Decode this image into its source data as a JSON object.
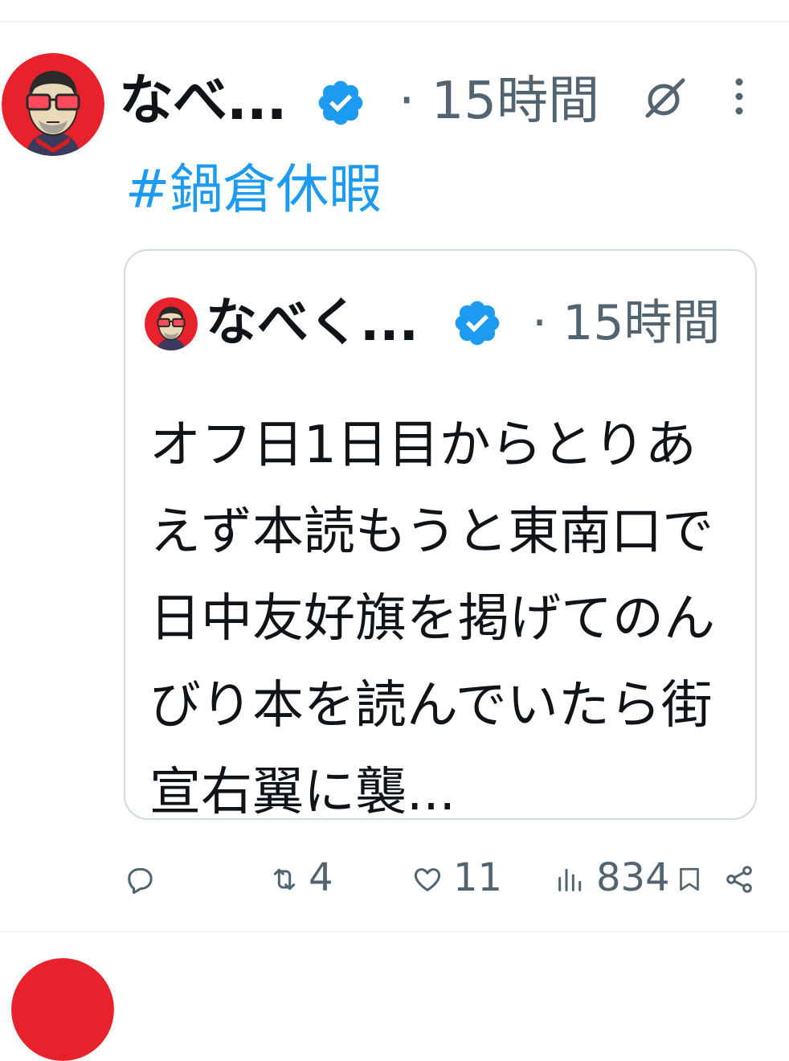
{
  "tweet": {
    "author_name": "なべ...",
    "time": "· 15時間",
    "hashtag": "#鍋倉休暇",
    "colors": {
      "text": "#0f1419",
      "secondary": "#536471",
      "link": "#1d9bf0",
      "verified": "#1d9bf0",
      "border": "#cfd9de",
      "avatar_bg": "#e8222c"
    },
    "icons": {
      "verified": "verified-badge-icon",
      "grok": "grok-icon",
      "more": "more-vertical-icon"
    }
  },
  "quote": {
    "author_name": "なべく...",
    "time": "· 15時間",
    "text": "オフ日1日目からとりあえず本読もうと東南口で日中友好旗を掲げてのんびり本を読んでいたら街宣右翼に襲..."
  },
  "actions": {
    "reply_count": "",
    "retweet_count": "4",
    "like_count": "11",
    "views_count": "834",
    "icons": [
      "reply-icon",
      "retweet-icon",
      "like-icon",
      "views-icon",
      "bookmark-icon",
      "share-icon"
    ]
  }
}
